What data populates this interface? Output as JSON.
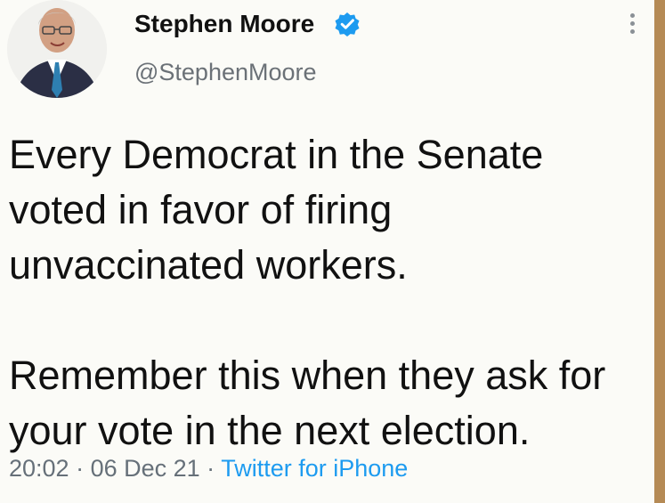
{
  "user": {
    "display_name": "Stephen Moore",
    "handle": "@StephenMoore",
    "verified_icon": "verified-badge-icon",
    "avatar_icon": "profile-photo"
  },
  "tweet": {
    "text": "Every Democrat in the Senate\nvoted in favor of firing\nunvaccinated workers.\n\nRemember this when they ask for\nyour vote in the next election."
  },
  "meta": {
    "time": "20:02",
    "separator_1": " · ",
    "date": "06 Dec 21",
    "separator_2": " · ",
    "source": "Twitter for iPhone"
  },
  "menu": {
    "icon": "more-options-icon"
  },
  "colors": {
    "accent": "#1d9bf0",
    "handle": "#6b7177",
    "text": "#111111",
    "background": "#fbfbf7"
  }
}
